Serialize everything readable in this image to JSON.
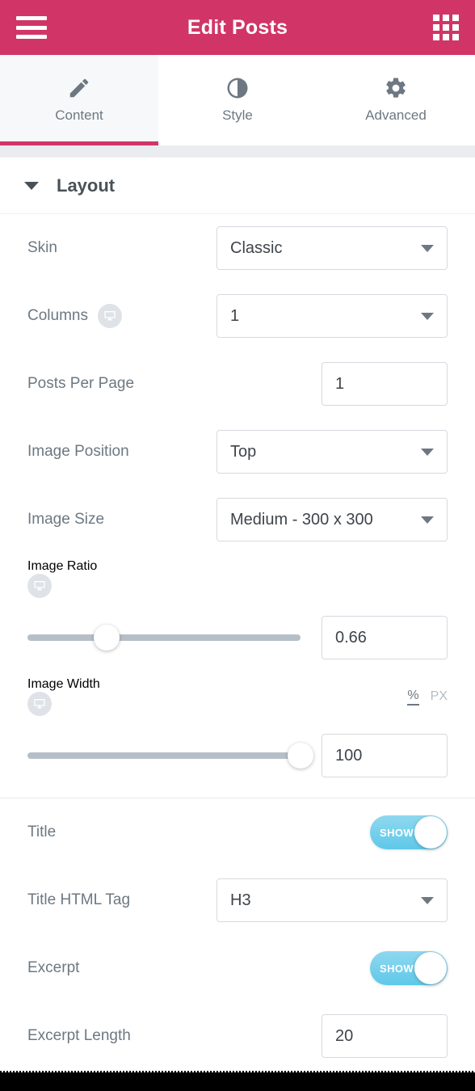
{
  "header": {
    "title": "Edit Posts",
    "menu_icon": "hamburger-icon",
    "apps_icon": "grid-apps-icon",
    "background_color": "#d13567"
  },
  "tabs": [
    {
      "label": "Content",
      "icon": "pencil-icon",
      "active": true
    },
    {
      "label": "Style",
      "icon": "contrast-icon",
      "active": false
    },
    {
      "label": "Advanced",
      "icon": "gear-icon",
      "active": false
    }
  ],
  "section": {
    "title": "Layout",
    "caret": "chevron-down-icon",
    "expanded": true
  },
  "controls": {
    "skin": {
      "label": "Skin",
      "value": "Classic"
    },
    "columns": {
      "label": "Columns",
      "value": "1",
      "device_icon": "desktop-icon"
    },
    "posts_per_page": {
      "label": "Posts Per Page",
      "value": "1"
    },
    "image_position": {
      "label": "Image Position",
      "value": "Top"
    },
    "image_size": {
      "label": "Image Size",
      "value": "Medium - 300 x 300"
    },
    "image_ratio": {
      "label": "Image Ratio",
      "device_icon": "desktop-icon",
      "value": "0.66",
      "slider_percent": 29
    },
    "image_width": {
      "label": "Image Width",
      "device_icon": "desktop-icon",
      "value": "100",
      "slider_percent": 100,
      "units": [
        {
          "label": "%",
          "active": true
        },
        {
          "label": "PX",
          "active": false
        }
      ]
    },
    "title": {
      "label": "Title",
      "toggle_label": "SHOW",
      "toggle_on": true
    },
    "title_html_tag": {
      "label": "Title HTML Tag",
      "value": "H3"
    },
    "excerpt": {
      "label": "Excerpt",
      "toggle_label": "SHOW",
      "toggle_on": true
    },
    "excerpt_length": {
      "label": "Excerpt Length",
      "value": "20"
    }
  },
  "colors": {
    "accent_pink": "#d13567",
    "toggle_blue": "#5ec8e8",
    "label_gray": "#6d7882",
    "value_dark": "#3f444b",
    "track_gray": "#b6bfc7"
  }
}
